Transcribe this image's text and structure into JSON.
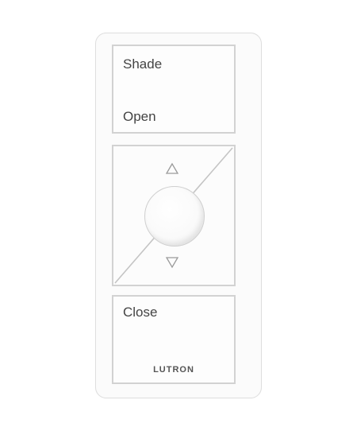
{
  "device": {
    "top_button": {
      "line1": "Shade",
      "line2": "Open"
    },
    "bottom_button": {
      "label": "Close"
    },
    "brand": "LUTRON",
    "colors": {
      "body": "#fbfbfb",
      "outline": "#d2d2d2",
      "text": "#444444"
    },
    "icons": {
      "raise": "up-triangle-icon",
      "lower": "down-triangle-icon"
    }
  }
}
